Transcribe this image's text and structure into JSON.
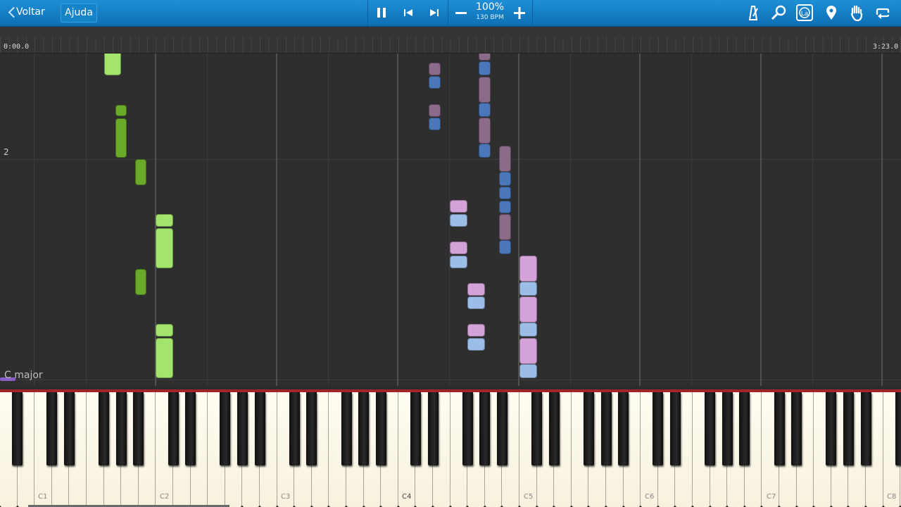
{
  "toolbar": {
    "back_label": "Voltar",
    "help_label": "Ajuda",
    "tempo_percent": "100%",
    "tempo_bpm": "130 BPM",
    "icons": [
      "pause-icon",
      "previous-icon",
      "next-icon",
      "minus-icon",
      "plus-icon",
      "metronome-icon",
      "search-icon",
      "note-label-icon",
      "marker-icon",
      "hand-icon",
      "loop-icon"
    ],
    "note_label_text": "La"
  },
  "timeline": {
    "start_time": "0:00.0",
    "end_time": "3:23.0"
  },
  "roll": {
    "bar_number": "2",
    "key_signature": "C major"
  },
  "keyboard": {
    "octave_labels": [
      "C1",
      "C2",
      "C3",
      "C4",
      "C5",
      "C6",
      "C7",
      "C8"
    ]
  },
  "colors": {
    "toolbar": "#1378c2",
    "left_hand_light": "#a3e46c",
    "left_hand_dark": "#6aab2c",
    "right_hand_pink": "#d3a2d8",
    "right_hand_light_blue": "#9bbde7",
    "right_hand_mauve": "#8c6a8a",
    "right_hand_blue": "#4b77b8"
  }
}
